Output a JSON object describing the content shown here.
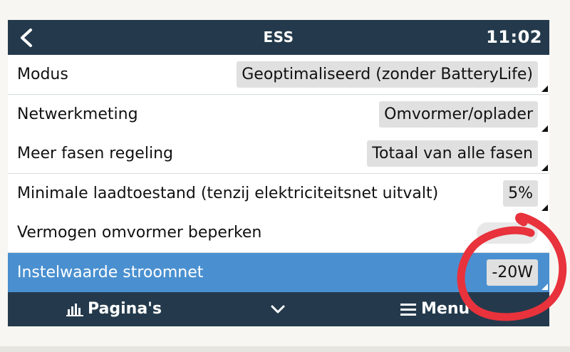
{
  "header": {
    "title": "ESS",
    "time": "11:02"
  },
  "settings": [
    {
      "label": "Modus",
      "value": "Geoptimaliseerd (zonder BatteryLife)"
    },
    {
      "label": "Netwerkmeting",
      "value": "Omvormer/oplader"
    },
    {
      "label": "Meer fasen regeling",
      "value": "Totaal van alle fasen"
    },
    {
      "label": "Minimale laadtoestand (tenzij elektriciteitsnet uitvalt)",
      "value": "5%"
    },
    {
      "label": "Vermogen omvormer beperken",
      "toggle_state": "off"
    },
    {
      "label": "Instelwaarde stroomnet",
      "value": "-20W",
      "selected": true
    }
  ],
  "footer": {
    "pages_label": "Pagina's",
    "menu_label": "Menu"
  },
  "icons": {
    "back": "back-arrow-icon",
    "pages": "bar-chart-icon",
    "chevron": "chevron-down-icon",
    "menu": "hamburger-menu-icon"
  },
  "colors": {
    "header_bg": "#243a4c",
    "selected_row": "#4a90d0",
    "value_box": "#e0e0e0",
    "annotation_red": "#e8323c"
  }
}
